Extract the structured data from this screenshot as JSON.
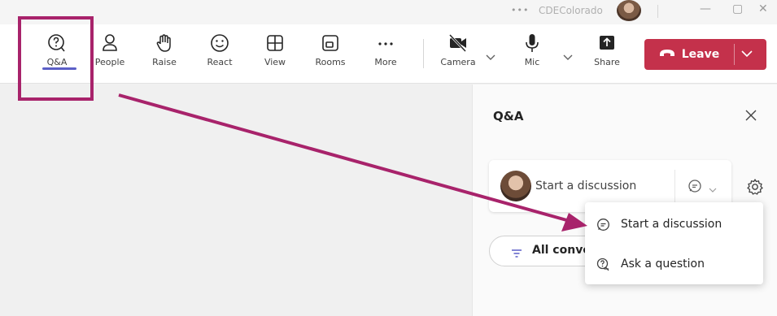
{
  "titlebar": {
    "more_label": "•••",
    "user_name": "CDEColorado",
    "minimize": "—",
    "maximize": "▢",
    "close": "✕"
  },
  "toolbar": {
    "items": [
      {
        "label": "Q&A",
        "icon": "qa-icon"
      },
      {
        "label": "People",
        "icon": "people-icon"
      },
      {
        "label": "Raise",
        "icon": "raise-hand-icon"
      },
      {
        "label": "React",
        "icon": "react-smiley-icon"
      },
      {
        "label": "View",
        "icon": "view-grid-icon"
      },
      {
        "label": "Rooms",
        "icon": "rooms-icon"
      },
      {
        "label": "More",
        "icon": "more-icon"
      },
      {
        "label": "Camera",
        "icon": "camera-off-icon"
      },
      {
        "label": "Mic",
        "icon": "mic-icon"
      },
      {
        "label": "Share",
        "icon": "share-icon"
      }
    ],
    "leave_label": "Leave"
  },
  "panel": {
    "title": "Q&A",
    "discussion_placeholder": "Start a discussion",
    "filter_label": "All conve"
  },
  "menu": {
    "items": [
      {
        "label": "Start a discussion",
        "icon": "discussion-icon"
      },
      {
        "label": "Ask a question",
        "icon": "question-icon"
      }
    ]
  },
  "colors": {
    "accent": "#5b5fc7",
    "leave": "#c4314b",
    "annotation": "#a8236b"
  }
}
